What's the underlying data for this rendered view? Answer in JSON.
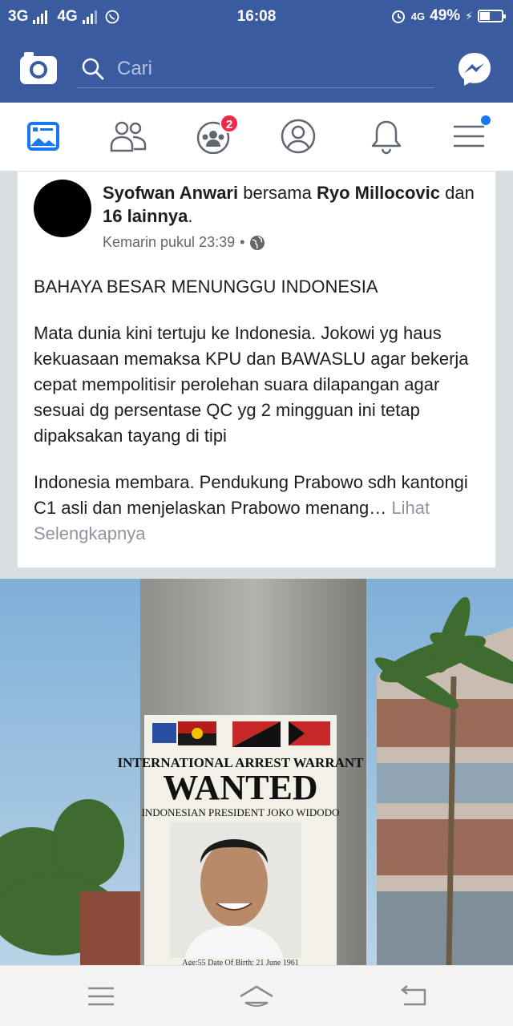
{
  "status_bar": {
    "network_1": "3G",
    "network_2": "4G",
    "time": "16:08",
    "lte": "4G",
    "battery": "49%"
  },
  "app_bar": {
    "search_placeholder": "Cari"
  },
  "nav_tabs": {
    "groups_badge": "2"
  },
  "post": {
    "author": "Syofwan Anwari",
    "with_word": "bersama",
    "tagged": "Ryo Millocovic",
    "and_word": "dan",
    "others": "16 lainnya",
    "period": ".",
    "timestamp": "Kemarin pukul 23:39",
    "dot": "•",
    "body_p1": "BAHAYA BESAR MENUNGGU INDONESIA",
    "body_p2": "Mata dunia kini tertuju ke Indonesia.  Jokowi yg haus kekuasaan memaksa KPU dan BAWASLU agar bekerja cepat mempolitisir perolehan suara dilapangan agar sesuai dg persentase QC yg 2 mingguan ini tetap dipaksakan tayang di tipi",
    "body_p3": "Indonesia membara.  Pendukung Prabowo sdh kantongi C1 asli dan menjelaskan Prabowo menang…",
    "see_more": "Lihat Selengkapnya"
  },
  "photo": {
    "poster_line1": "INTERNATIONAL ARREST WARRANT",
    "poster_line2": "WANTED",
    "poster_line3": "INDONESIAN PRESIDENT JOKO WIDODO",
    "poster_footer": "Age:55   Date Of Birth: 21 June 1961"
  }
}
